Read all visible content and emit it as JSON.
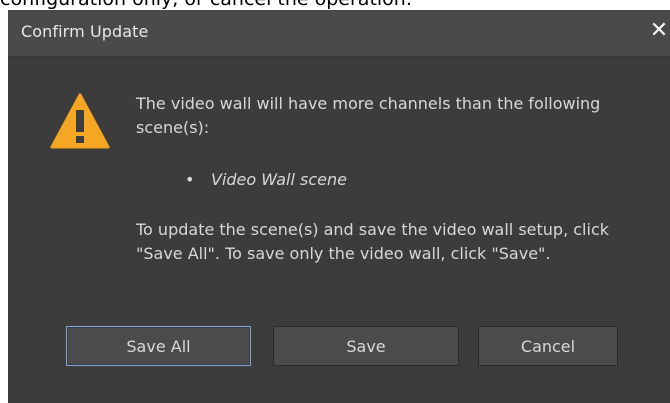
{
  "background_text": "configuration only, or cancel the operation.",
  "dialog": {
    "title": "Confirm Update",
    "close_glyph": "✕",
    "icon": "warning-icon",
    "message_line1": "The video wall will have more channels than the following scene(s):",
    "bullet_glyph": "•",
    "scene_name": "Video Wall scene",
    "message_line2": "To update the scene(s) and save the video wall setup, click \"Save All\". To save only the video wall, click \"Save\"."
  },
  "buttons": {
    "save_all": "Save All",
    "save": "Save",
    "cancel": "Cancel"
  },
  "colors": {
    "dialog_bg": "#3c3c3c",
    "titlebar_bg": "#4a4a4a",
    "warning": "#f5a623",
    "text": "#d8d8d8",
    "focus_border": "#8aa4c8"
  }
}
